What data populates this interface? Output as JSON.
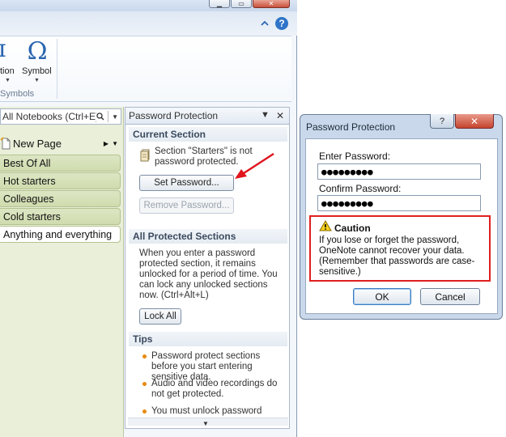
{
  "ribbon": {
    "partial_button_label": "tion",
    "symbol_button_label": "Symbol",
    "symbol_glyph": "Ω",
    "partial_glyph": "π",
    "group_label": "Symbols"
  },
  "nav": {
    "notebook_search": "All Notebooks (Ctrl+E)",
    "new_page_label": "New Page",
    "sections": [
      {
        "label": "Best Of All"
      },
      {
        "label": "Hot starters"
      },
      {
        "label": "Colleagues"
      },
      {
        "label": "Cold starters"
      },
      {
        "label": "Anything and everything"
      }
    ]
  },
  "pane": {
    "title": "Password Protection",
    "current_section_heading": "Current Section",
    "status_text": "Section \"Starters\" is not password protected.",
    "set_password_label": "Set Password...",
    "remove_password_label": "Remove Password...",
    "all_protected_heading": "All Protected Sections",
    "lock_description": "When you enter a password protected section, it remains unlocked for a period of time. You can lock any unlocked sections now. (Ctrl+Alt+L)",
    "lock_all_label": "Lock All",
    "tips_heading": "Tips",
    "tips": [
      "Password protect sections before you start entering sensitive data.",
      "Audio and video recordings do not get protected.",
      "You must unlock password"
    ]
  },
  "dialog": {
    "title": "Password Protection",
    "help_label": "?",
    "close_label": "✕",
    "enter_password_label": "Enter Password:",
    "enter_password_value": "●●●●●●●●●",
    "confirm_password_label": "Confirm Password:",
    "confirm_password_value": "●●●●●●●●●",
    "caution_title": "Caution",
    "caution_text": "If you lose or forget the password, OneNote cannot recover your data. (Remember that passwords are case-sensitive.)",
    "ok_label": "OK",
    "cancel_label": "Cancel"
  },
  "colors": {
    "accent_blue": "#2a66b0",
    "section_green": "#cfdcae",
    "caution_red": "#e02020",
    "tip_orange": "#e8890c",
    "annotation_arrow": "#e0141c"
  }
}
